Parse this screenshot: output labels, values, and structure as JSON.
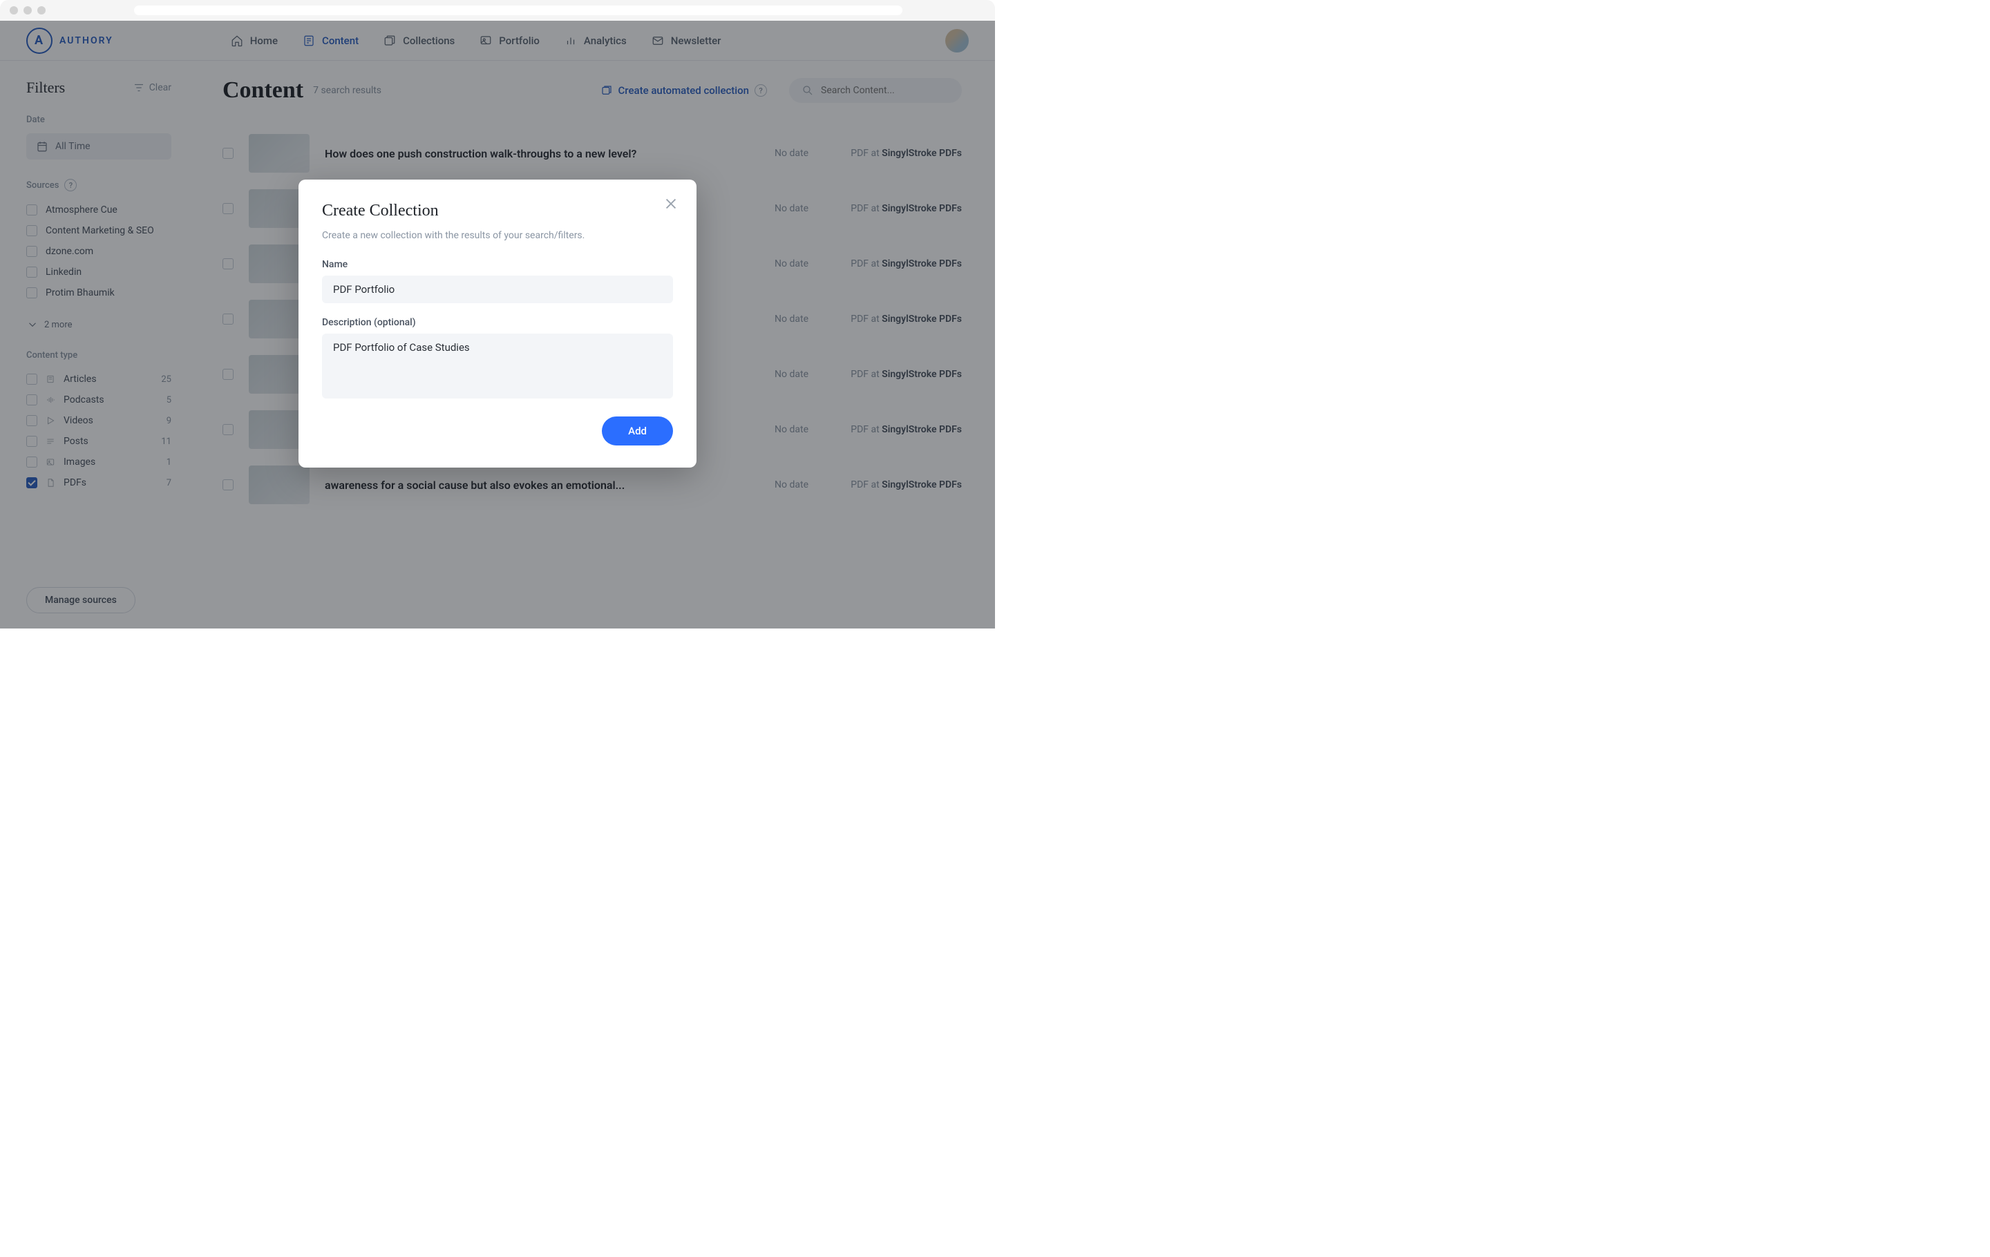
{
  "brand": {
    "name": "AUTHORY",
    "mark": "A"
  },
  "nav": {
    "items": [
      {
        "label": "Home"
      },
      {
        "label": "Content",
        "active": true
      },
      {
        "label": "Collections"
      },
      {
        "label": "Portfolio"
      },
      {
        "label": "Analytics"
      },
      {
        "label": "Newsletter"
      }
    ]
  },
  "sidebar": {
    "title": "Filters",
    "clear": "Clear",
    "date_label": "Date",
    "date_value": "All Time",
    "sources_label": "Sources",
    "sources": [
      {
        "label": "Atmosphere Cue"
      },
      {
        "label": "Content Marketing & SEO"
      },
      {
        "label": "dzone.com"
      },
      {
        "label": "Linkedin"
      },
      {
        "label": "Protim Bhaumik"
      }
    ],
    "more": "2 more",
    "type_label": "Content type",
    "types": [
      {
        "label": "Articles",
        "count": "25",
        "icon": "article"
      },
      {
        "label": "Podcasts",
        "count": "5",
        "icon": "podcast"
      },
      {
        "label": "Videos",
        "count": "9",
        "icon": "video"
      },
      {
        "label": "Posts",
        "count": "11",
        "icon": "post"
      },
      {
        "label": "Images",
        "count": "1",
        "icon": "image"
      },
      {
        "label": "PDFs",
        "count": "7",
        "icon": "pdf",
        "checked": true
      }
    ],
    "manage": "Manage sources"
  },
  "main": {
    "title": "Content",
    "result_count": "7 search results",
    "create_auto": "Create automated collection",
    "search_placeholder": "Search Content...",
    "source_prefix": "PDF",
    "source_at": "at",
    "source_name": "SingylStroke PDFs",
    "rows": [
      {
        "title": "How does one push construction walk-throughs to a new level?",
        "date": "No date"
      },
      {
        "title": "",
        "date": "No date"
      },
      {
        "title": "",
        "date": "No date"
      },
      {
        "title": "",
        "date": "No date"
      },
      {
        "title": "",
        "date": "No date"
      },
      {
        "title": "",
        "date": "No date"
      },
      {
        "title": "awareness for a social cause but also evokes an emotional...",
        "date": "No date"
      }
    ]
  },
  "modal": {
    "title": "Create Collection",
    "subtitle": "Create a new collection with the results of your search/filters.",
    "name_label": "Name",
    "name_value": "PDF Portfolio",
    "desc_label": "Description (optional)",
    "desc_value": "PDF Portfolio of Case Studies",
    "add": "Add"
  }
}
